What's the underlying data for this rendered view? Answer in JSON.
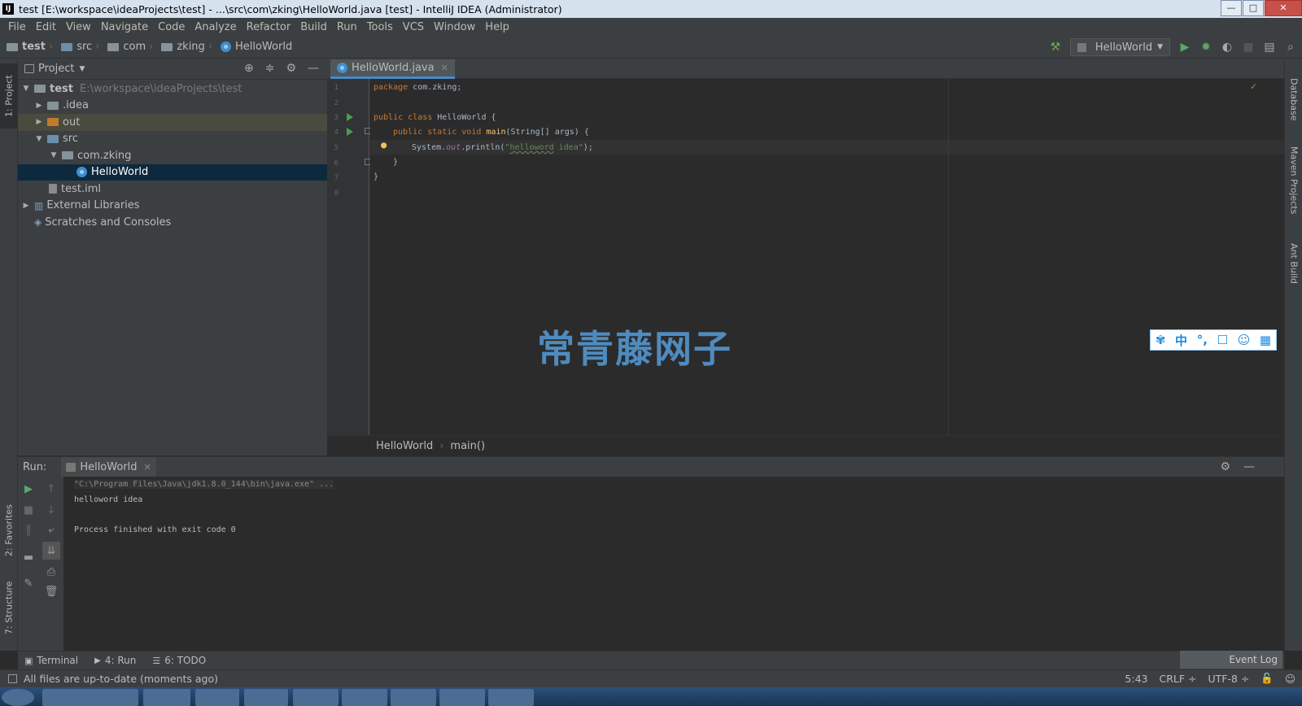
{
  "window": {
    "title": "test [E:\\workspace\\ideaProjects\\test] - ...\\src\\com\\zking\\HelloWorld.java [test] - IntelliJ IDEA (Administrator)",
    "logo": "IJ",
    "min": "—",
    "max": "□",
    "close": "✕"
  },
  "menu": [
    "File",
    "Edit",
    "View",
    "Navigate",
    "Code",
    "Analyze",
    "Refactor",
    "Build",
    "Run",
    "Tools",
    "VCS",
    "Window",
    "Help"
  ],
  "breadcrumb": [
    "test",
    "src",
    "com",
    "zking",
    "HelloWorld"
  ],
  "toolbar": {
    "run_config": "HelloWorld"
  },
  "left_stripe": {
    "project": "1: Project",
    "favorites": "2: Favorites",
    "structure": "7: Structure"
  },
  "right_stripe": {
    "database": "Database",
    "maven": "Maven Projects",
    "ant": "Ant Build"
  },
  "project": {
    "header": "Project",
    "tree": [
      {
        "label": "test",
        "path": "E:\\workspace\\ideaProjects\\test"
      },
      {
        "label": ".idea"
      },
      {
        "label": "out"
      },
      {
        "label": "src"
      },
      {
        "label": "com.zking"
      },
      {
        "label": "HelloWorld"
      },
      {
        "label": "test.iml"
      },
      {
        "label": "External Libraries"
      },
      {
        "label": "Scratches and Consoles"
      }
    ]
  },
  "editor": {
    "tab": "HelloWorld.java",
    "line_numbers": [
      "1",
      "2",
      "3",
      "4",
      "5",
      "6",
      "7",
      "8"
    ],
    "code": {
      "l1_kw": "package",
      "l1_rest": " com.zking;",
      "l3_kw": "public class",
      "l3_rest": " HelloWorld {",
      "l4_kw": "public static void",
      "l4_fn": "main",
      "l4_rest": "(String[] args) {",
      "l5_a": "System.",
      "l5_fld": "out",
      "l5_b": ".println(",
      "l5_q1": "\"",
      "l5_str1": "helloword",
      "l5_str2": " idea\"",
      "l5_c": ");",
      "l6": "}",
      "l7": "}"
    },
    "breadcrumb": [
      "HelloWorld",
      "main()"
    ]
  },
  "watermark": "常青藤网子",
  "ime": [
    "中",
    "°,",
    "☐",
    "☺",
    "▦"
  ],
  "run": {
    "label": "Run:",
    "tab": "HelloWorld",
    "console": [
      "\"C:\\Program Files\\Java\\jdk1.8.0_144\\bin\\java.exe\" ...",
      "helloword idea",
      "",
      "Process finished with exit code 0"
    ]
  },
  "bottom_tabs": [
    "Terminal",
    "4: Run",
    "6: TODO"
  ],
  "event_log": "Event Log",
  "status": {
    "message": "All files are up-to-date (moments ago)",
    "position": "5:43",
    "line_sep": "CRLF ÷",
    "encoding": "UTF-8 ÷"
  }
}
